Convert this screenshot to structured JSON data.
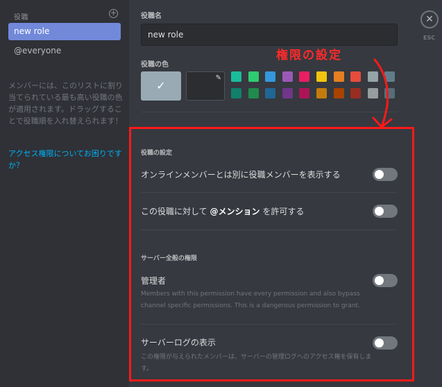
{
  "sidebar": {
    "header": "役職",
    "add_icon": "plus-circle-icon",
    "roles": [
      "new role",
      "@everyone"
    ],
    "description": "メンバーには、このリストに割り当てられている最も高い役職の色が適用されます。ドラッグすることで役職順を入れ替えられます！",
    "help_link": "アクセス権限についてお困りですか？"
  },
  "close": {
    "icon": "close-icon",
    "label": "ESC"
  },
  "role_name": {
    "label": "役職名",
    "value": "new role"
  },
  "role_color": {
    "label": "役職の色",
    "default_color": "#99aab5",
    "swatches_top": [
      "#1abc9c",
      "#2ecc71",
      "#3498db",
      "#9b59b6",
      "#e91e63",
      "#f1c40f",
      "#e67e22",
      "#e74c3c",
      "#95a5a6",
      "#607d8b"
    ],
    "swatches_bottom": [
      "#11806a",
      "#1f8b4c",
      "#206694",
      "#71368a",
      "#ad1457",
      "#c27c0e",
      "#a84300",
      "#992d22",
      "#979c9f",
      "#546e7a"
    ]
  },
  "annotation": {
    "text": "権限の設定",
    "color": "#ff1a1a"
  },
  "role_settings": {
    "title": "役職の設定",
    "hoist_label": "オンラインメンバーとは別に役職メンバーを表示する",
    "mention_prefix": "この役職に対して",
    "mention_bold": "@メンション",
    "mention_suffix": "を許可する"
  },
  "general_permissions": {
    "title": "サーバー全般の権限",
    "admin_label": "管理者",
    "admin_desc": "Members with this permission have every permission and also bypass channel specific permissions. This is a dangerous permission to grant.",
    "audit_label": "サーバーログの表示",
    "audit_desc": "この権限が与えられたメンバーは、サーバーの管理ログへのアクセス権を保有します。"
  }
}
